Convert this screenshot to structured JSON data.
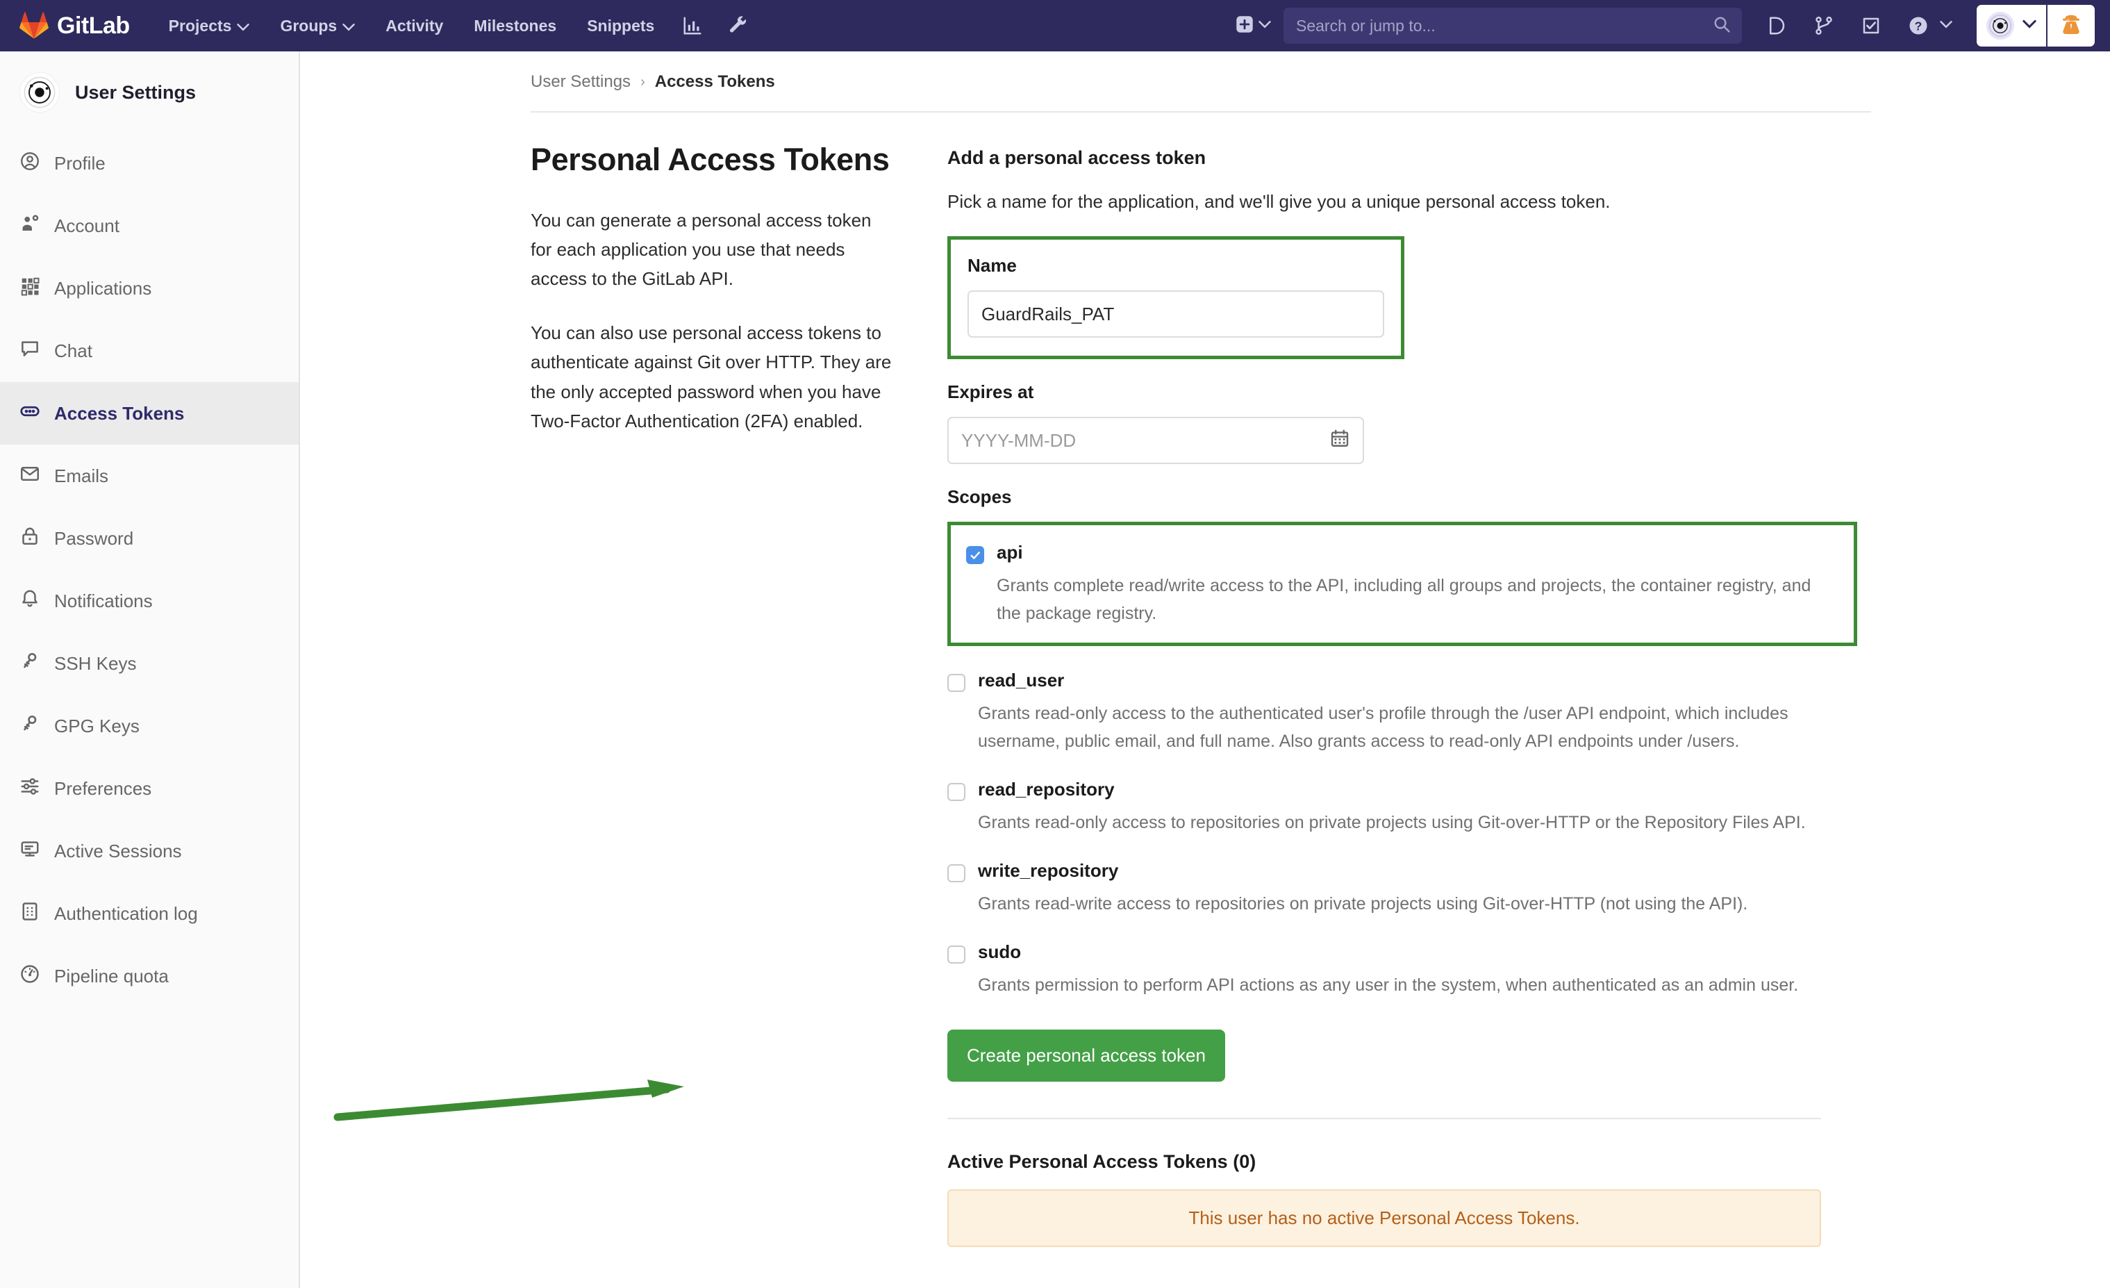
{
  "navbar": {
    "brand": "GitLab",
    "brand_icon": "gitlab-logo-icon",
    "links": [
      {
        "label": "Projects",
        "caret": "⌄",
        "has_caret": true
      },
      {
        "label": "Groups",
        "caret": "⌄",
        "has_caret": true
      },
      {
        "label": "Activity",
        "has_caret": false
      },
      {
        "label": "Milestones",
        "has_caret": false
      },
      {
        "label": "Snippets",
        "has_caret": false
      }
    ],
    "icons": [
      "chart-bars-icon",
      "wrench-icon"
    ],
    "plus_icon": "plus-square-icon",
    "plus_caret": "⌄",
    "search": {
      "placeholder": "Search or jump to...",
      "icon": "search-icon"
    },
    "right_icons": [
      "issues-icon",
      "merge-requests-icon",
      "todos-icon",
      "help-icon"
    ],
    "help_caret": "⌄",
    "user": {
      "avatar_icon": "user-avatar-icon",
      "caret": "⌄",
      "secondary_icon": "incognito-icon"
    },
    "bg_color": "#2e2a5d"
  },
  "sidebar": {
    "title": "User Settings",
    "avatar_icon": "user-avatar-icon",
    "items": [
      {
        "label": "Profile",
        "icon": "profile-icon",
        "active": false
      },
      {
        "label": "Account",
        "icon": "account-gear-icon",
        "active": false
      },
      {
        "label": "Applications",
        "icon": "applications-grid-icon",
        "active": false
      },
      {
        "label": "Chat",
        "icon": "chat-bubble-icon",
        "active": false
      },
      {
        "label": "Access Tokens",
        "icon": "token-icon",
        "active": true
      },
      {
        "label": "Emails",
        "icon": "envelope-icon",
        "active": false
      },
      {
        "label": "Password",
        "icon": "lock-icon",
        "active": false
      },
      {
        "label": "Notifications",
        "icon": "bell-icon",
        "active": false
      },
      {
        "label": "SSH Keys",
        "icon": "key-icon",
        "active": false
      },
      {
        "label": "GPG Keys",
        "icon": "key-icon",
        "active": false
      },
      {
        "label": "Preferences",
        "icon": "sliders-icon",
        "active": false
      },
      {
        "label": "Active Sessions",
        "icon": "monitor-icon",
        "active": false
      },
      {
        "label": "Authentication log",
        "icon": "log-list-icon",
        "active": false
      },
      {
        "label": "Pipeline quota",
        "icon": "gauge-icon",
        "active": false
      }
    ]
  },
  "breadcrumb": {
    "parent": "User Settings",
    "separator": "›",
    "current": "Access Tokens"
  },
  "page": {
    "title": "Personal Access Tokens",
    "paragraph1": "You can generate a personal access token for each application you use that needs access to the GitLab API.",
    "paragraph2": "You can also use personal access tokens to authenticate against Git over HTTP. They are the only accepted password when you have Two-Factor Authentication (2FA) enabled."
  },
  "form": {
    "heading": "Add a personal access token",
    "subheading": "Pick a name for the application, and we'll give you a unique personal access token.",
    "name_label": "Name",
    "name_value": "GuardRails_PAT",
    "expires_label": "Expires at",
    "expires_placeholder": "YYYY-MM-DD",
    "expires_icon": "calendar-icon",
    "scopes_label": "Scopes",
    "scopes": [
      {
        "name": "api",
        "checked": true,
        "highlighted": true,
        "description": "Grants complete read/write access to the API, including all groups and projects, the container registry, and the package registry."
      },
      {
        "name": "read_user",
        "checked": false,
        "highlighted": false,
        "description": "Grants read-only access to the authenticated user's profile through the /user API endpoint, which includes username, public email, and full name. Also grants access to read-only API endpoints under /users."
      },
      {
        "name": "read_repository",
        "checked": false,
        "highlighted": false,
        "description": "Grants read-only access to repositories on private projects using Git-over-HTTP or the Repository Files API."
      },
      {
        "name": "write_repository",
        "checked": false,
        "highlighted": false,
        "description": "Grants read-write access to repositories on private projects using Git-over-HTTP (not using the API)."
      },
      {
        "name": "sudo",
        "checked": false,
        "highlighted": false,
        "description": "Grants permission to perform API actions as any user in the system, when authenticated as an admin user."
      }
    ],
    "submit_label": "Create personal access token"
  },
  "active_tokens": {
    "heading": "Active Personal Access Tokens (0)",
    "empty_message": "This user has no active Personal Access Tokens."
  },
  "annotations": {
    "highlight_color": "#3c8b33",
    "arrow_color": "#3c8b33",
    "checkbox_color": "#4a90e8",
    "button_color": "#43a047"
  }
}
